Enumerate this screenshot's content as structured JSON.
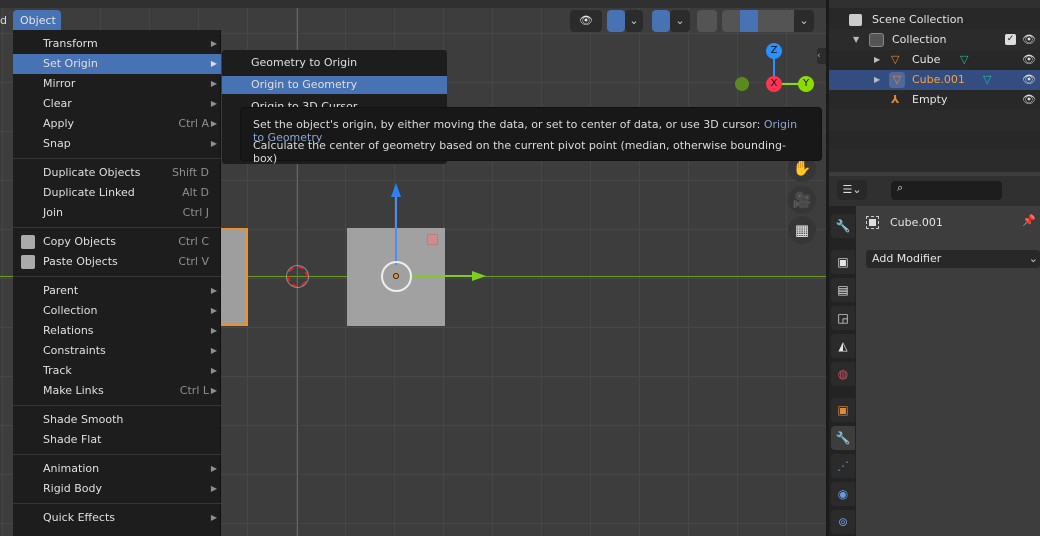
{
  "header": {
    "object_menu": "Object",
    "left_cut_label": "d"
  },
  "object_menu": {
    "items": [
      {
        "label": "Transform",
        "submenu": true
      },
      {
        "label": "Set Origin",
        "submenu": true,
        "selected": true
      },
      {
        "label": "Mirror",
        "submenu": true
      },
      {
        "label": "Clear",
        "submenu": true
      },
      {
        "label": "Apply",
        "shortcut": "Ctrl A",
        "submenu": true
      },
      {
        "label": "Snap",
        "submenu": true
      },
      {
        "label": "Duplicate Objects",
        "shortcut": "Shift D"
      },
      {
        "label": "Duplicate Linked",
        "shortcut": "Alt D"
      },
      {
        "label": "Join",
        "shortcut": "Ctrl J"
      },
      {
        "label": "Copy Objects",
        "shortcut": "Ctrl C",
        "icon": "copy-icon"
      },
      {
        "label": "Paste Objects",
        "shortcut": "Ctrl V",
        "icon": "paste-icon"
      },
      {
        "label": "Parent",
        "submenu": true
      },
      {
        "label": "Collection",
        "submenu": true
      },
      {
        "label": "Relations",
        "submenu": true
      },
      {
        "label": "Constraints",
        "submenu": true
      },
      {
        "label": "Track",
        "submenu": true
      },
      {
        "label": "Make Links",
        "shortcut": "Ctrl L",
        "submenu": true
      },
      {
        "label": "Shade Smooth"
      },
      {
        "label": "Shade Flat"
      },
      {
        "label": "Animation",
        "submenu": true
      },
      {
        "label": "Rigid Body",
        "submenu": true
      },
      {
        "label": "Quick Effects",
        "submenu": true
      }
    ]
  },
  "set_origin_submenu": {
    "items": [
      {
        "label": "Geometry to Origin"
      },
      {
        "label": "Origin to Geometry",
        "selected": true
      },
      {
        "label": "Origin to 3D Cursor"
      }
    ]
  },
  "tooltip": {
    "line1": "Set the object's origin, by either moving the data, or set to center of data, or use 3D cursor:",
    "python": "Origin to Geometry",
    "line2": "Calculate the center of geometry based on the current pivot point (median, otherwise bounding-box)"
  },
  "gizmo": {
    "z": "Z",
    "x": "X",
    "y": "Y"
  },
  "outliner": {
    "scene_collection": "Scene Collection",
    "collection": "Collection",
    "items": [
      {
        "label": "Cube"
      },
      {
        "label": "Cube.001",
        "selected": true
      },
      {
        "label": "Empty"
      }
    ]
  },
  "properties": {
    "object_name": "Cube.001",
    "add_modifier": "Add Modifier",
    "active_tab": "modifiers"
  },
  "colors": {
    "accent": "#4772b3",
    "selected_object": "#ffa030",
    "x_axis": "#ff3352",
    "y_axis": "#8bdc00",
    "z_axis": "#2890ff"
  }
}
